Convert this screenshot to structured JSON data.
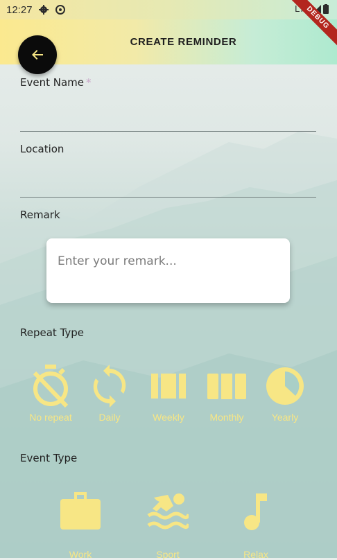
{
  "statusbar": {
    "time": "12:27",
    "network": "LTE",
    "debug": "DEBUG"
  },
  "appbar": {
    "title": "CREATE REMINDER",
    "back_icon": "arrow-left-icon"
  },
  "form": {
    "event_name_label": "Event Name",
    "required_mark": "*",
    "event_name_value": "",
    "location_label": "Location",
    "location_value": "",
    "remark_label": "Remark",
    "remark_placeholder": "Enter your remark...",
    "repeat_type_label": "Repeat Type",
    "event_type_label": "Event Type"
  },
  "repeat_types": [
    {
      "label": "No repeat",
      "icon": "timer-off-icon"
    },
    {
      "label": "Daily",
      "icon": "sync-icon"
    },
    {
      "label": "Weekly",
      "icon": "view-week-icon"
    },
    {
      "label": "Monthly",
      "icon": "view-column-icon"
    },
    {
      "label": "Yearly",
      "icon": "pie-icon"
    }
  ],
  "event_types": [
    {
      "label": "Work",
      "icon": "briefcase-icon"
    },
    {
      "label": "Sport",
      "icon": "swimming-icon"
    },
    {
      "label": "Relax",
      "icon": "music-note-icon"
    }
  ],
  "colors": {
    "accent": "#f7e685",
    "appbar_start": "#fbe98f",
    "appbar_end": "#aeeacf",
    "back_button": "#0b0b0b"
  }
}
